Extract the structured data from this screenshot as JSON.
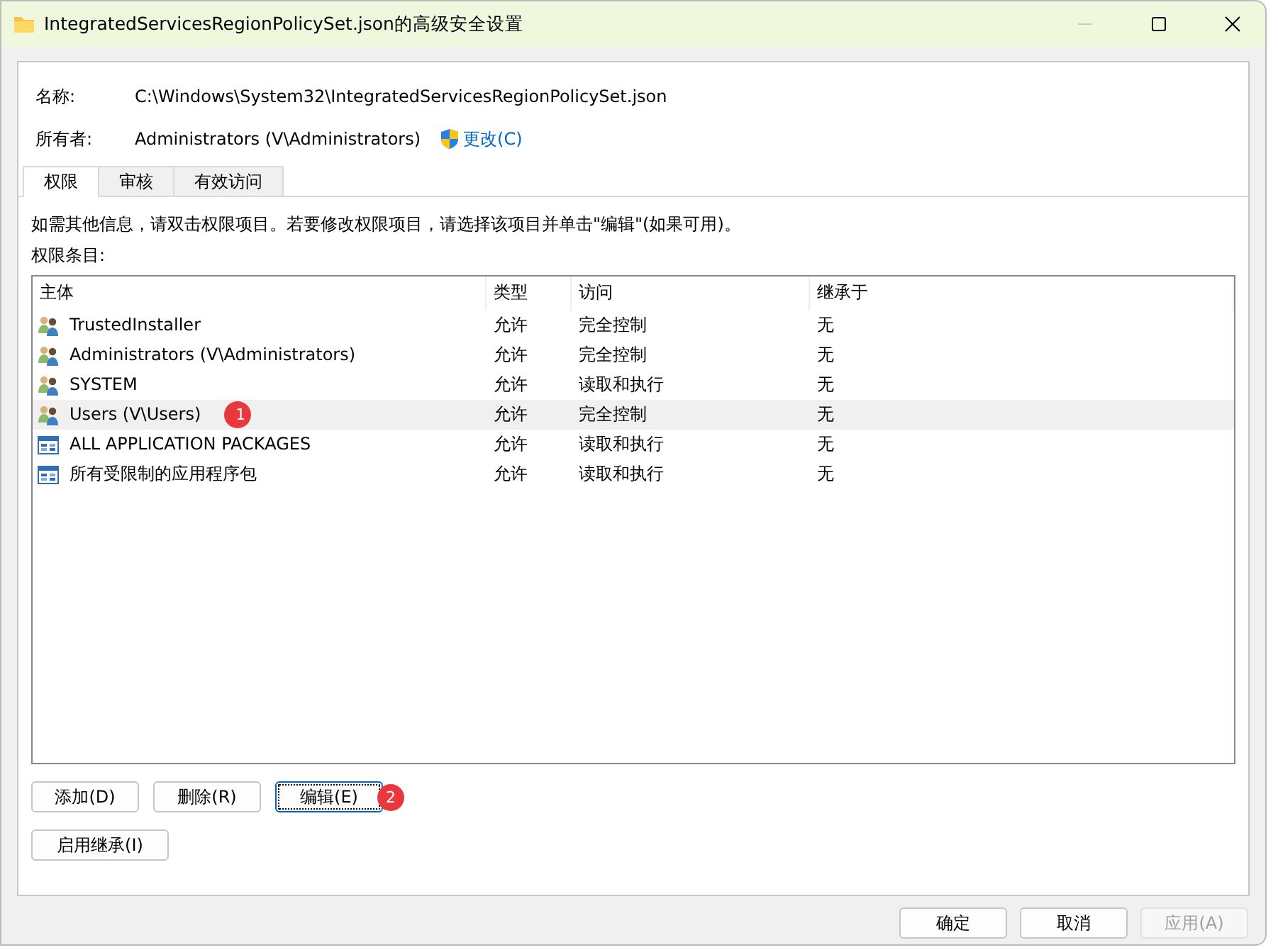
{
  "window": {
    "title": "IntegratedServicesRegionPolicySet.json的高级安全设置"
  },
  "info": [
    {
      "label": "名称:",
      "value": "C:\\Windows\\System32\\IntegratedServicesRegionPolicySet.json"
    },
    {
      "label": "所有者:",
      "value": "Administrators (V\\Administrators)",
      "link": "更改(C)"
    }
  ],
  "tabs": [
    {
      "label": "权限",
      "selected": true
    },
    {
      "label": "审核",
      "selected": false
    },
    {
      "label": "有效访问",
      "selected": false
    }
  ],
  "hint": "如需其他信息，请双击权限项目。若要修改权限项目，请选择该项目并单击\"编辑\"(如果可用)。",
  "list_label": "权限条目:",
  "table": {
    "columns": [
      "主体",
      "类型",
      "访问",
      "继承于"
    ],
    "rows": [
      {
        "kind": "group",
        "cells": [
          "TrustedInstaller",
          "允许",
          "完全控制",
          "无"
        ],
        "selected": false
      },
      {
        "kind": "group",
        "cells": [
          "Administrators (V\\Administrators)",
          "允许",
          "完全控制",
          "无"
        ],
        "selected": false
      },
      {
        "kind": "group",
        "cells": [
          "SYSTEM",
          "允许",
          "读取和执行",
          "无"
        ],
        "selected": false
      },
      {
        "kind": "group",
        "cells": [
          "Users (V\\Users)",
          "允许",
          "完全控制",
          "无"
        ],
        "selected": true,
        "marker": "1"
      },
      {
        "kind": "package",
        "cells": [
          "ALL APPLICATION PACKAGES",
          "允许",
          "读取和执行",
          "无"
        ],
        "selected": false
      },
      {
        "kind": "package",
        "cells": [
          "所有受限制的应用程序包",
          "允许",
          "读取和执行",
          "无"
        ],
        "selected": false
      }
    ]
  },
  "actions": [
    {
      "label": "添加(D)",
      "focused": false
    },
    {
      "label": "删除(R)",
      "focused": false
    },
    {
      "label": "编辑(E)",
      "focused": true,
      "marker": "2"
    }
  ],
  "inherit_button": "启用继承(I)",
  "footer": [
    {
      "label": "确定",
      "disabled": false
    },
    {
      "label": "取消",
      "disabled": false
    },
    {
      "label": "应用(A)",
      "disabled": true
    }
  ]
}
